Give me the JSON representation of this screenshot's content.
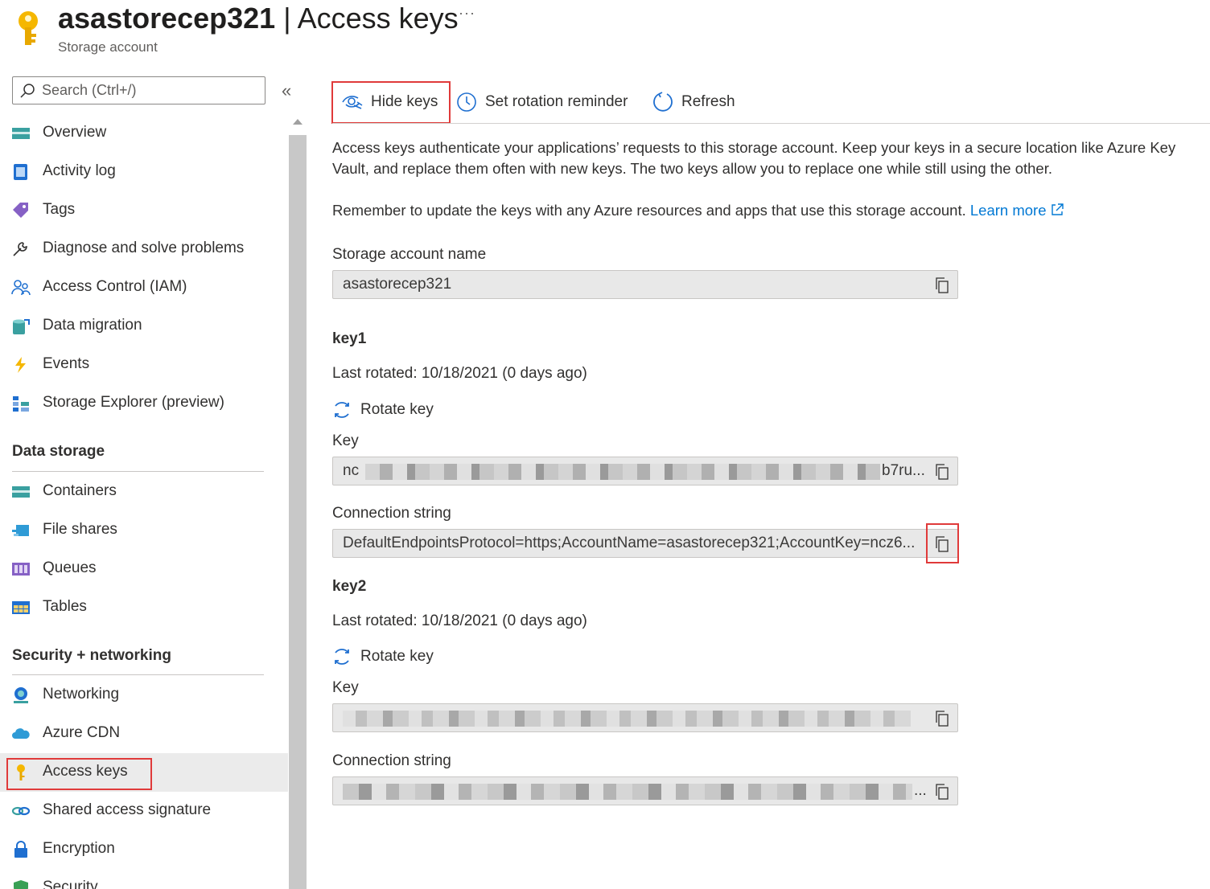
{
  "header": {
    "resource_name": "asastorecep321",
    "separator": " | ",
    "page_name": "Access keys",
    "subtitle": "Storage account",
    "more": "···"
  },
  "sidebar": {
    "search_placeholder": "Search (Ctrl+/)",
    "collapse": "«",
    "items_top": [
      {
        "label": "Overview",
        "icon": "overview-icon"
      },
      {
        "label": "Activity log",
        "icon": "activity-log-icon"
      },
      {
        "label": "Tags",
        "icon": "tag-icon"
      },
      {
        "label": "Diagnose and solve problems",
        "icon": "wrench-icon"
      },
      {
        "label": "Access Control (IAM)",
        "icon": "people-icon"
      },
      {
        "label": "Data migration",
        "icon": "data-migration-icon"
      },
      {
        "label": "Events",
        "icon": "lightning-icon"
      },
      {
        "label": "Storage Explorer (preview)",
        "icon": "storage-explorer-icon"
      }
    ],
    "section_data_storage": "Data storage",
    "items_data_storage": [
      {
        "label": "Containers",
        "icon": "containers-icon"
      },
      {
        "label": "File shares",
        "icon": "file-shares-icon"
      },
      {
        "label": "Queues",
        "icon": "queues-icon"
      },
      {
        "label": "Tables",
        "icon": "tables-icon"
      }
    ],
    "section_security": "Security + networking",
    "items_security": [
      {
        "label": "Networking",
        "icon": "networking-icon"
      },
      {
        "label": "Azure CDN",
        "icon": "cloud-icon"
      },
      {
        "label": "Access keys",
        "icon": "key-icon"
      },
      {
        "label": "Shared access signature",
        "icon": "link-icon"
      },
      {
        "label": "Encryption",
        "icon": "lock-icon"
      },
      {
        "label": "Security",
        "icon": "shield-icon"
      }
    ]
  },
  "toolbar": {
    "hide_keys": "Hide keys",
    "set_rotation_reminder": "Set rotation reminder",
    "refresh": "Refresh"
  },
  "content": {
    "intro": "Access keys authenticate your applications’ requests to this storage account. Keep your keys in a secure location like Azure Key Vault, and replace them often with new keys. The two keys allow you to replace one while still using the other.",
    "reminder": "Remember to update the keys with any Azure resources and apps that use this storage account.",
    "learn_more": "Learn more",
    "storage_account_name_label": "Storage account name",
    "storage_account_name_value": "asastorecep321",
    "key1": {
      "title": "key1",
      "last_rotated": "Last rotated: 10/18/2021 (0 days ago)",
      "rotate": "Rotate key",
      "key_label": "Key",
      "key_prefix": "nc",
      "key_suffix": "b7ru...",
      "conn_label": "Connection string",
      "conn_value": "DefaultEndpointsProtocol=https;AccountName=asastorecep321;AccountKey=ncz6..."
    },
    "key2": {
      "title": "key2",
      "last_rotated": "Last rotated: 10/18/2021 (0 days ago)",
      "rotate": "Rotate key",
      "key_label": "Key",
      "conn_label": "Connection string",
      "conn_suffix": "..."
    }
  },
  "colors": {
    "accent": "#0078d4",
    "highlight_box": "#e03a3a",
    "field_bg": "#e8e8e8",
    "selected_nav_bg": "#ebebeb"
  }
}
